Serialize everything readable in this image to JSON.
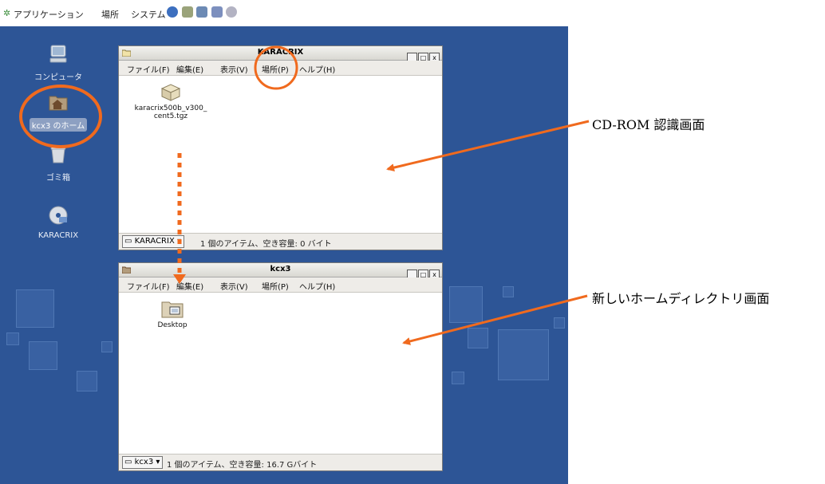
{
  "panel": {
    "menus": [
      "アプリケーション",
      "場所",
      "システム"
    ],
    "launcher_icons": [
      "browser-icon",
      "mail-icon",
      "search-icon",
      "editor-icon",
      "help-icon"
    ]
  },
  "desktop": {
    "icons": [
      {
        "label": "コンピュータ",
        "icon": "computer-icon"
      },
      {
        "label": "kcx3 のホーム",
        "icon": "home-folder-icon"
      },
      {
        "label": "ゴミ箱",
        "icon": "trash-icon"
      },
      {
        "label": "KARACRIX",
        "icon": "cdrom-icon"
      }
    ]
  },
  "window1": {
    "title": "KARACRIX",
    "menus": [
      "ファイル(F)",
      "編集(E)",
      "表示(V)",
      "場所(P)",
      "ヘルプ(H)"
    ],
    "file": {
      "line1": "karacrix500b_v300_",
      "line2": "cent5.tgz",
      "icon": "archive-icon"
    },
    "location": "KARACRIX",
    "status": "1 個のアイテム、空き容量: 0 バイト",
    "buttons": {
      "minimize": "_",
      "maximize": "□",
      "close": "x"
    }
  },
  "window2": {
    "title": "kcx3",
    "menus": [
      "ファイル(F)",
      "編集(E)",
      "表示(V)",
      "場所(P)",
      "ヘルプ(H)"
    ],
    "file": {
      "label": "Desktop",
      "icon": "desktop-folder-icon"
    },
    "location": "kcx3",
    "status": "1 個のアイテム、空き容量: 16.7 Gバイト",
    "buttons": {
      "minimize": "_",
      "maximize": "□",
      "close": "x"
    }
  },
  "annotations": {
    "top": "CD-ROM 認識画面",
    "bottom": "新しいホームディレクトリ画面",
    "color": "#f06a1e"
  },
  "colors": {
    "desktop": "#2d5596",
    "accent": "#f06a1e"
  }
}
